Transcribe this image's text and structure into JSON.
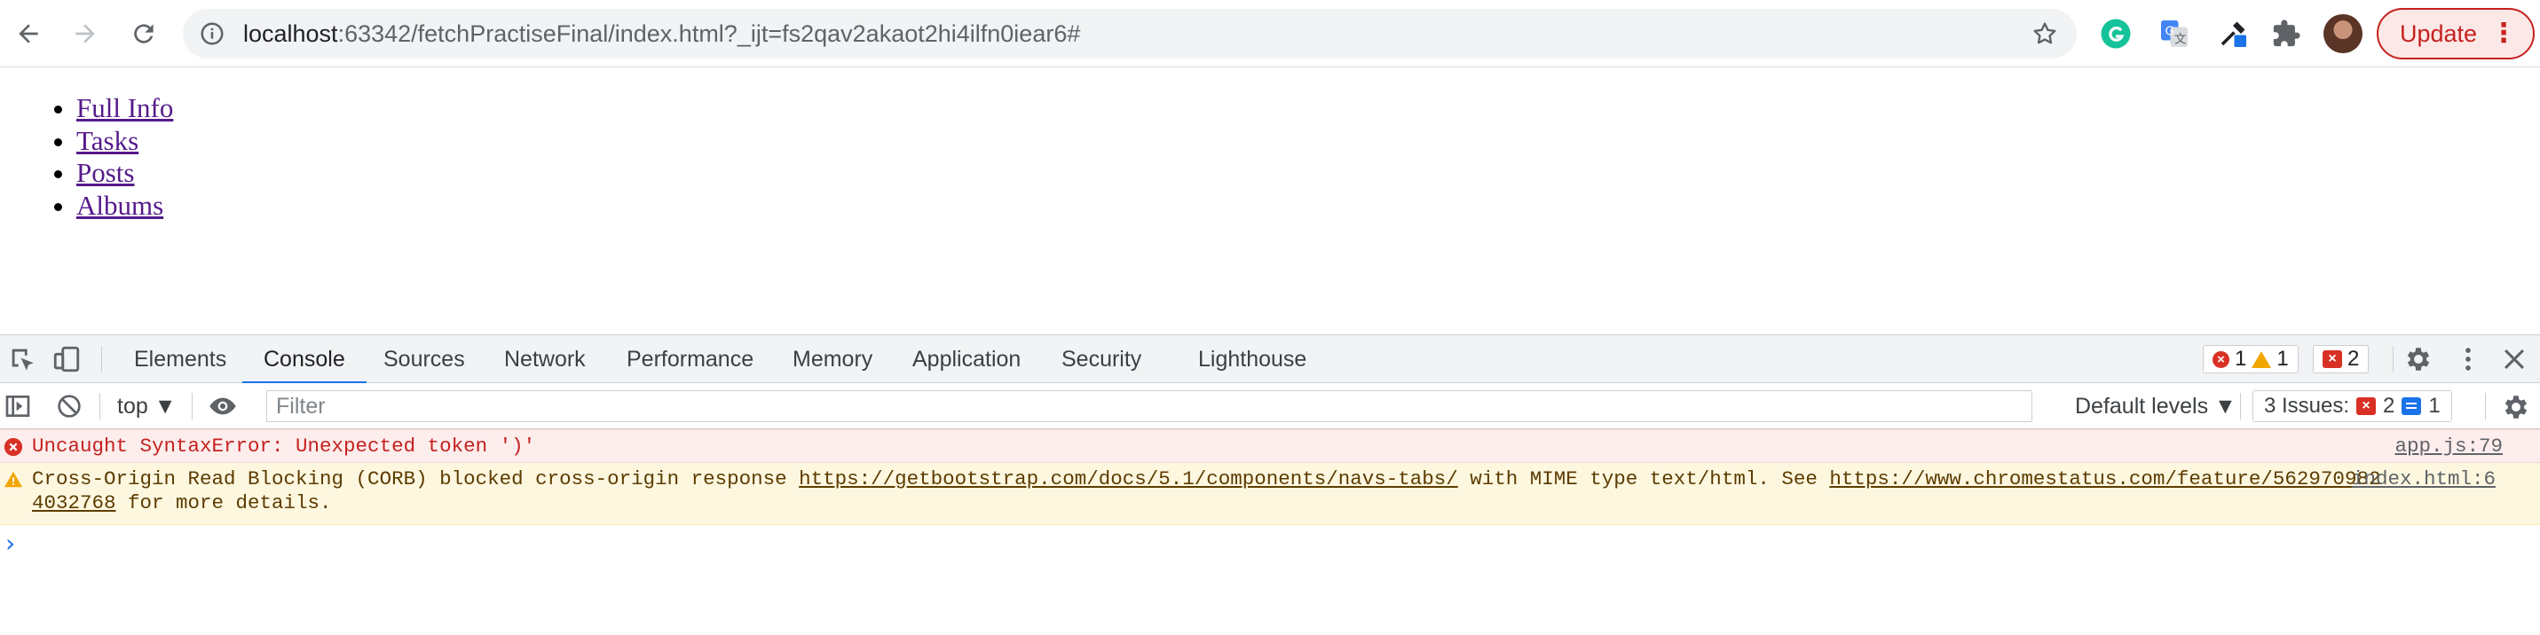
{
  "browser": {
    "url_host": "localhost",
    "url_rest": ":63342/fetchPractiseFinal/index.html?_ijt=fs2qav2akaot2hi4ilfn0iear6#",
    "update_label": "Update",
    "update_menu": "⋮",
    "extensions": [
      "grammarly-icon",
      "google-translate-icon",
      "color-picker-icon",
      "puzzle-extension-icon"
    ]
  },
  "page": {
    "links": [
      "Full Info",
      "Tasks",
      "Posts",
      "Albums"
    ]
  },
  "devtools": {
    "tabs": [
      "Elements",
      "Console",
      "Sources",
      "Network",
      "Performance",
      "Memory",
      "Application",
      "Security",
      "Lighthouse"
    ],
    "active_tab": "Console",
    "error_count": "1",
    "warning_count": "1",
    "issue_badge_count": "2",
    "context": "top ▼",
    "filter_placeholder": "Filter",
    "levels_label": "Default levels ▼",
    "issues_label": "3 Issues:",
    "issues_red": "2",
    "issues_blue": "1",
    "messages": {
      "error_text": "Uncaught SyntaxError: Unexpected token ')'",
      "error_source": "app.js:79",
      "warning_pre": "Cross-Origin Read Blocking (CORB) blocked cross-origin response ",
      "warning_link1": "https://getbootstrap.com/docs/5.1/components/navs-tabs/",
      "warning_mid": " with MIME type text/html. See ",
      "warning_link2a": "https://www.chromestatus.com/feature/562970982",
      "warning_link2b": "4032768",
      "warning_post": " for more details.",
      "warning_source": "index.html:6"
    },
    "prompt": "›"
  },
  "colors": {
    "link_visited": "#551a8b",
    "active_tab_underline": "#1a73e8",
    "error_red": "#d93025",
    "warning_yellow": "#f2a600",
    "update_red": "#c5221f"
  }
}
